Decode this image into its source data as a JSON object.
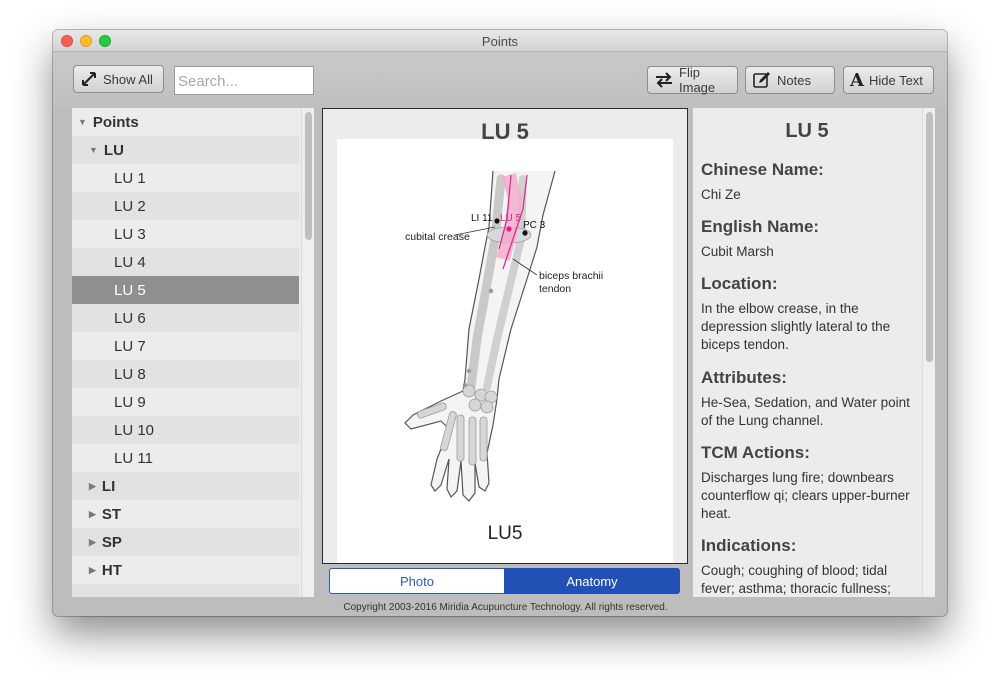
{
  "window": {
    "title": "Points"
  },
  "toolbar": {
    "show_all": "Show All",
    "search_placeholder": "Search...",
    "flip_image": "Flip Image",
    "notes": "Notes",
    "hide_text": "Hide Text"
  },
  "tree": {
    "root": "Points",
    "group_open": "LU",
    "points": [
      "LU 1",
      "LU 2",
      "LU 3",
      "LU 4",
      "LU 5",
      "LU 6",
      "LU 7",
      "LU 8",
      "LU 9",
      "LU 10",
      "LU 11"
    ],
    "selected": "LU 5",
    "groups": [
      "LI",
      "ST",
      "SP",
      "HT"
    ]
  },
  "image_panel": {
    "title": "LU 5",
    "caption": "LU5",
    "labels": {
      "li11": "LI 11",
      "lu5": "LU 5",
      "pc3": "PC 3",
      "cubital_crease": "cubital crease",
      "biceps_line1": "biceps brachii",
      "biceps_line2": "tendon"
    },
    "tab_photo": "Photo",
    "tab_anatomy": "Anatomy",
    "active_tab": "Anatomy"
  },
  "copyright": "Copyright 2003-2016 Miridia Acupuncture Technology.  All rights reserved.",
  "details": {
    "title": "LU 5",
    "chinese_name_h": "Chinese Name:",
    "chinese_name": "Chi Ze",
    "english_name_h": "English Name:",
    "english_name": "Cubit Marsh",
    "location_h": "Location:",
    "location": "In the elbow crease, in the depression slightly lateral to the biceps tendon.",
    "attributes_h": "Attributes:",
    "attributes": "He-Sea, Sedation, and Water point of the Lung channel.",
    "tcm_actions_h": "TCM Actions:",
    "tcm_actions": "Discharges lung fire; downbears counterflow qi; clears upper-burner heat.",
    "indications_h": "Indications:",
    "indications": "Cough; coughing of blood; tidal fever; asthma; thoracic fullness;"
  },
  "colors": {
    "accent": "#2151b5",
    "meridian": "#e0218a",
    "selected_row": "#8f8f8f"
  }
}
